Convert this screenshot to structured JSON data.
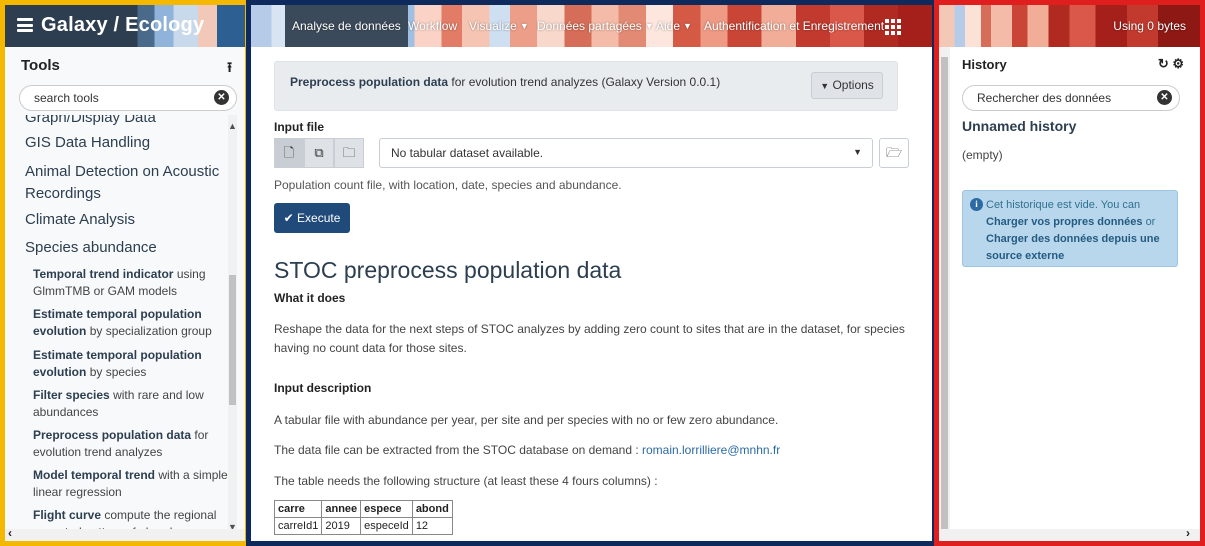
{
  "left": {
    "brand": "Galaxy / Ecology",
    "tools_title": "Tools",
    "search_placeholder": "search tools",
    "categories": {
      "graph": "Graph/Display Data",
      "gis": "GIS Data Handling",
      "animal": "Animal Detection on Acoustic Recordings",
      "climate": "Climate Analysis",
      "species": "Species abundance"
    },
    "tools": [
      {
        "name": "Temporal trend indicator",
        "desc": "using GlmmTMB or GAM models"
      },
      {
        "name": "Estimate temporal population evolution",
        "desc": "by specialization group"
      },
      {
        "name": "Estimate temporal population evolution",
        "desc": "by species"
      },
      {
        "name": "Filter species",
        "desc": "with rare and low abundances"
      },
      {
        "name": "Preprocess population data",
        "desc": "for evolution trend analyzes"
      },
      {
        "name": "Model temporal trend",
        "desc": "with a simple linear regression"
      },
      {
        "name": "Flight curve",
        "desc": "compute the regional expected pattern of abundance"
      }
    ]
  },
  "nav": {
    "items": [
      "Analyse de données",
      "Workflow",
      "Visualize",
      "Données partagées",
      "Aide",
      "Authentification et Enregistrement"
    ]
  },
  "main": {
    "tool_name": "Preprocess population data",
    "tool_desc": "for evolution trend analyzes (Galaxy Version 0.0.1)",
    "options_label": "Options",
    "input_label": "Input file",
    "select_value": "No tabular dataset available.",
    "input_help": "Population count file, with location, date, species and abundance.",
    "execute_label": "Execute",
    "heading": "STOC preprocess population data",
    "what_it_does": "What it does",
    "what_text": "Reshape the data for the next steps of STOC analyzes by adding zero count to sites that are in the dataset, for species having no count data for those sites.",
    "input_desc": "Input description",
    "input_desc_text": "A tabular file with abundance per year, per site and per species with no or few zero abundance.",
    "extract_text": "The data file can be extracted from the STOC database on demand : ",
    "email": "romain.lorrilliere@mnhn.fr",
    "structure_text": "The table needs the following structure (at least these 4 fours columns) :",
    "table_headers": [
      "carre",
      "annee",
      "espece",
      "abond"
    ],
    "table_row": [
      "carreId1",
      "2019",
      "especeId",
      "12"
    ]
  },
  "right": {
    "using": "Using 0 bytes",
    "history_title": "History",
    "search_placeholder": "Rechercher des données",
    "history_name": "Unnamed history",
    "empty": "(empty)",
    "info_pre": "Cet historique est vide. You can",
    "info_link1": "Charger vos propres données",
    "info_or": "or",
    "info_link2": "Charger des données depuis une source externe"
  }
}
